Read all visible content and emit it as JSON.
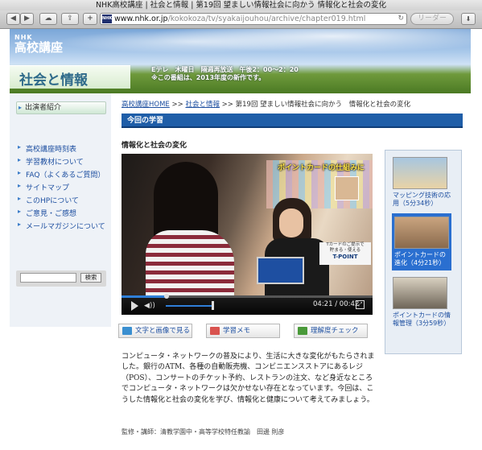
{
  "window": {
    "title": "NHK高校講座 | 社会と情報 | 第19回 望ましい情報社会に向かう 情報化と社会の変化"
  },
  "toolbar": {
    "back_icon": "◀",
    "forward_icon": "▶",
    "cloud_icon": "☁",
    "share_icon": "⇪",
    "add_icon": "+",
    "favicon_text": "NHK",
    "address_host": "www.nhk.or.jp",
    "address_path": "/kokokoza/tv/syakaijouhou/archive/chapter019.html",
    "reload_icon": "↻",
    "reader_label": "リーダー",
    "download_icon": "⬇"
  },
  "header": {
    "nhk_logo": "NHK",
    "kouza_logo": "高校講座",
    "program_title": "社会と情報",
    "air_info_line1": "Eテレ　木曜日　隔週再放送　午後2：00～2：20",
    "air_info_line2": "※この番組は、2013年度の新作です。"
  },
  "sidebar": {
    "cast_button": "出演者紹介",
    "items": [
      {
        "label": "高校講座時刻表"
      },
      {
        "label": "学習教材について"
      },
      {
        "label": "FAQ（よくあるご質問）"
      },
      {
        "label": "サイトマップ"
      },
      {
        "label": "このHPについて"
      },
      {
        "label": "ご意見・ご感想"
      },
      {
        "label": "メールマガジンについて"
      }
    ],
    "search_placeholder": "",
    "search_button": "検索"
  },
  "breadcrumb": {
    "home": "高校講座HOME",
    "sep1": " >> ",
    "program": "社会と情報",
    "sep2": " >> ",
    "current": "第19回 望ましい情報社会に向かう　情報化と社会の変化"
  },
  "main": {
    "section_header": "今回の学習",
    "chapter_title": "情報化と社会の変化",
    "video": {
      "caption": "ポイントカードの仕組みに",
      "register_sign": "T-POINT",
      "register_note": "Tカードのご提示で\n貯まる・使える",
      "current_time": "04:21",
      "duration": "00:42",
      "time_sep": " / ",
      "progress": 0.18,
      "volume": 0.9,
      "play_icon": "play-icon",
      "volume_icon": "volume-icon",
      "fullscreen_icon": "fullscreen-icon"
    },
    "buttons": {
      "text_image": "文字と画像で見る",
      "memo": "学習メモ",
      "check": "理解度チェック"
    },
    "description": "コンピュータ・ネットワークの普及により、生活に大きな変化がもたらされました。銀行のATM、各種の自動販売機、コンビニエンスストアにあるレジ（POS）、コンサートのチケット予約、レストランの注文、など身近なところでコンピュータ・ネットワークは欠かせない存在となっています。今回は、こうした情報化と社会の変化を学び、情報化と健康について考えてみましょう。",
    "credit": "監修・講師：清教学園中・高等学校特任教諭　田邊 則彦"
  },
  "clips": [
    {
      "title": "マッピング技術の応用（5分34秒）",
      "active": false
    },
    {
      "title": "ポイントカードの進化（4分21秒）",
      "active": true
    },
    {
      "title": "ポイントカードの情報管理（3分59秒）",
      "active": false
    }
  ],
  "colors": {
    "accent": "#1f5ea8",
    "link": "#1d4fa0",
    "active_clip": "#2a6fd0"
  }
}
